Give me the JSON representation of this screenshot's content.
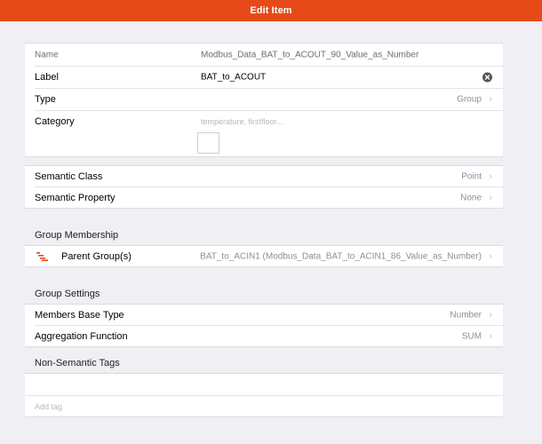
{
  "navbar": {
    "title": "Edit Item"
  },
  "item": {
    "name_label": "Name",
    "name_value": "Modbus_Data_BAT_to_ACOUT_90_Value_as_Number",
    "label_label": "Label",
    "label_value": "BAT_to_ACOUT",
    "type_label": "Type",
    "type_value": "Group",
    "category_label": "Category",
    "category_placeholder": "temperature, firstfloor..."
  },
  "semantics": {
    "class_label": "Semantic Class",
    "class_value": "Point",
    "property_label": "Semantic Property",
    "property_value": "None"
  },
  "group_membership": {
    "title": "Group Membership",
    "parent_label": "Parent Group(s)",
    "parent_value": "BAT_to_ACIN1 (Modbus_Data_BAT_to_ACIN1_86_Value_as_Number)"
  },
  "group_settings": {
    "title": "Group Settings",
    "base_type_label": "Members Base Type",
    "base_type_value": "Number",
    "aggregation_label": "Aggregation Function",
    "aggregation_value": "SUM"
  },
  "tags": {
    "title": "Non-Semantic Tags",
    "add_placeholder": "Add tag"
  },
  "colors": {
    "accent": "#e64a19",
    "background": "#efeff4"
  },
  "icons": {
    "clear": "clear-circle-icon",
    "chevron": "chevron-right-icon",
    "list": "list-icon"
  }
}
